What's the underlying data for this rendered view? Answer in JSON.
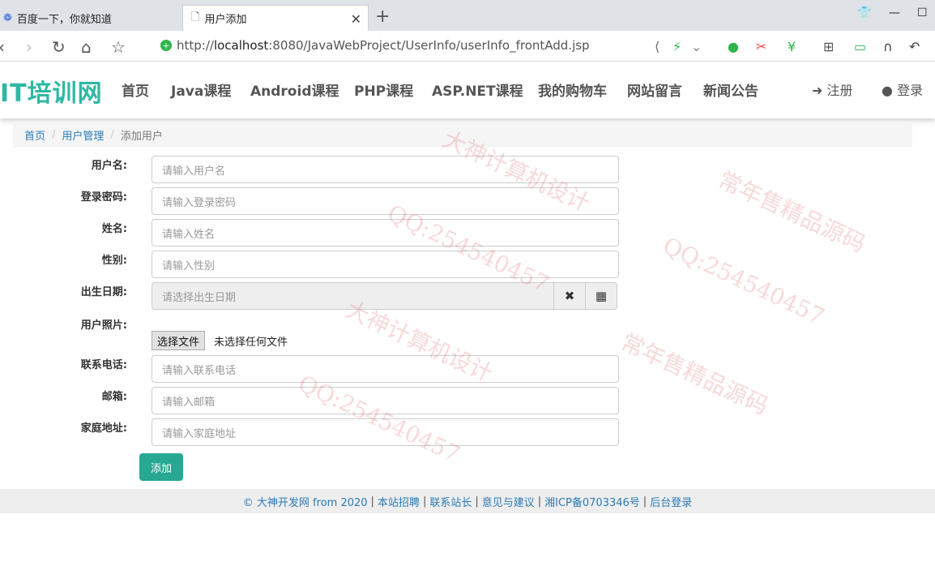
{
  "browser": {
    "tabs": [
      {
        "title": "百度一下，你就知道"
      },
      {
        "title": "用户添加"
      }
    ],
    "url_prefix": "http://",
    "url_host": "localhost",
    "url_rest": ":8080/JavaWebProject/UserInfo/userInfo_frontAdd.jsp"
  },
  "header": {
    "logo": "IT培训网",
    "menu": [
      "首页",
      "Java课程",
      "Android课程",
      "PHP课程",
      "ASP.NET课程",
      "我的购物车",
      "网站留言",
      "新闻公告"
    ],
    "register": "注册",
    "login": "登录"
  },
  "breadcrumb": {
    "home": "首页",
    "section": "用户管理",
    "current": "添加用户"
  },
  "form": {
    "username": {
      "label": "用户名:",
      "placeholder": "请输入用户名"
    },
    "password": {
      "label": "登录密码:",
      "placeholder": "请输入登录密码"
    },
    "name": {
      "label": "姓名:",
      "placeholder": "请输入姓名"
    },
    "gender": {
      "label": "性别:",
      "placeholder": "请输入性别"
    },
    "birthday": {
      "label": "出生日期:",
      "placeholder": "请选择出生日期"
    },
    "photo": {
      "label": "用户照片:",
      "button": "选择文件",
      "status": "未选择任何文件"
    },
    "phone": {
      "label": "联系电话:",
      "placeholder": "请输入联系电话"
    },
    "email": {
      "label": "邮箱:",
      "placeholder": "请输入邮箱"
    },
    "address": {
      "label": "家庭地址:",
      "placeholder": "请输入家庭地址"
    },
    "submit": "添加"
  },
  "footer": {
    "copyright": "© 大神开发网 from 2020",
    "links": [
      "本站招聘",
      "联系站长",
      "意见与建议",
      "湘ICP备0703346号",
      "后台登录"
    ]
  },
  "watermarks": [
    "QQ:254540457",
    "大神计算机设计",
    "常年售精品源码"
  ]
}
